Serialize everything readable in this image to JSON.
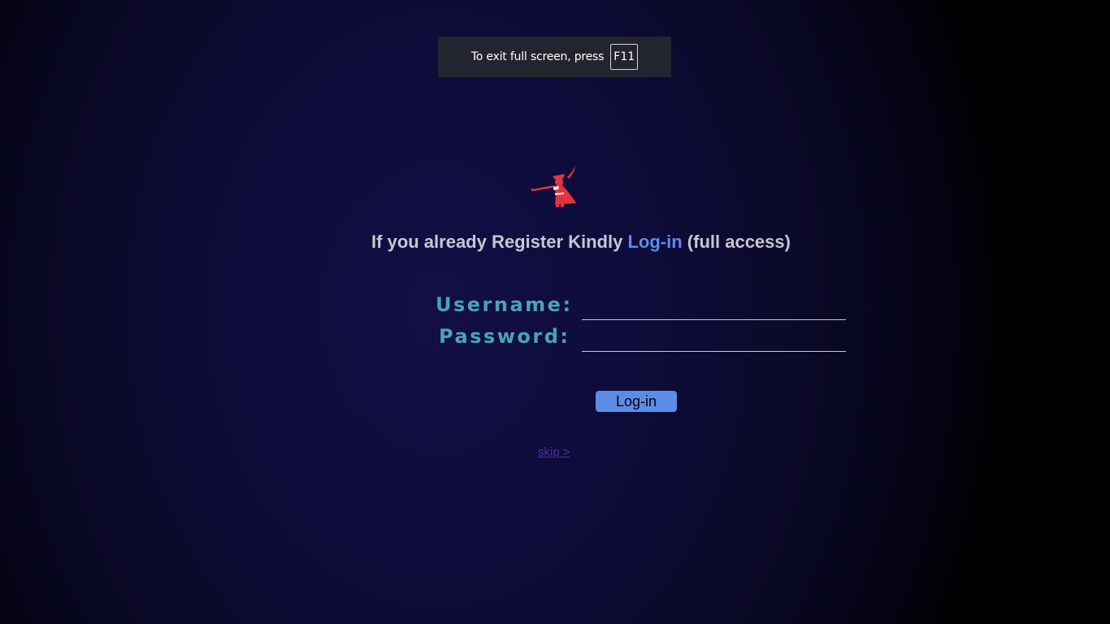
{
  "fullscreen_notice": {
    "message": "To exit full screen, press",
    "key": "F11"
  },
  "logo": {
    "icon": "trumpeter-logo-icon",
    "color": "#e0353f"
  },
  "headline": {
    "prefix": "If you already Register Kindly",
    "link": "Log-in",
    "suffix": "(full access)"
  },
  "form": {
    "username_label": "Username:",
    "username_value": "",
    "password_label": "Password:",
    "password_value": "",
    "submit_label": "Log-in"
  },
  "skip": {
    "label": "skip >"
  },
  "colors": {
    "accent": "#5b8de6",
    "label": "#4aa3b4",
    "link_visited": "#4b2fa6",
    "background": "#0e0c3a"
  }
}
